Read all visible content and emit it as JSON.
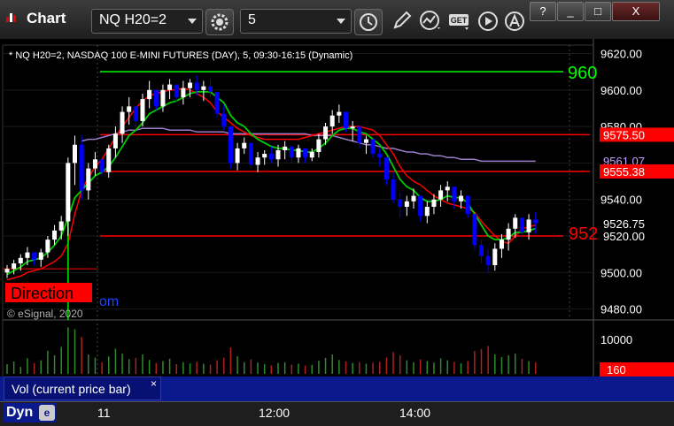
{
  "app": {
    "title": "Chart",
    "symbol": "NQ H20=2",
    "interval": "5"
  },
  "toolbar": {
    "icons": [
      "settings-gear-icon",
      "clock-icon",
      "pencil-draw-icon",
      "study-icon",
      "get-data-icon",
      "play-icon",
      "annotate-icon"
    ],
    "get_label": "GET"
  },
  "window_buttons": [
    "?",
    "_",
    "□",
    "X"
  ],
  "chart_header": "* NQ H20=2, NASDAQ 100 E-MINI FUTURES (DAY), 5, 09:30-16:15 (Dynamic)",
  "overlays": {
    "direction_label": "Direction",
    "copyright": "© eSignal, 2020",
    "partial_com": "om"
  },
  "price_axis": {
    "ticks": [
      "9620.00",
      "9600.00",
      "9580.00",
      "9560.00",
      "9540.00",
      "9520.00",
      "9500.00",
      "9480.00"
    ]
  },
  "price_tags": [
    {
      "text": "9575.50",
      "bg": "#ff0000",
      "fg": "#ffffff"
    },
    {
      "text": "9561.07",
      "bg": "#000000",
      "fg": "#c8a0ff"
    },
    {
      "text": "9555.38",
      "bg": "#ff0000",
      "fg": "#ffffff"
    },
    {
      "text": "9526.75",
      "bg": "#000000",
      "fg": "#ffffff"
    },
    {
      "text": "9520.00",
      "bg": "#000000",
      "fg": "#ffffff"
    }
  ],
  "line_labels": {
    "green_line": "960",
    "red_line": "952"
  },
  "volume_axis": {
    "tick": "10000",
    "current_tag": "160"
  },
  "volume_panel": {
    "label": "Vol (current price bar)",
    "close": "×"
  },
  "time_axis": {
    "labels": [
      "11",
      "12:00",
      "14:00"
    ],
    "dyn_label": "Dyn"
  },
  "colors": {
    "up": "#ffffff",
    "down": "#0000ff",
    "ma_fast": "#00cc00",
    "ma_slow": "#ff0000",
    "ma_long": "#9a7cc8",
    "hline_green": "#00ff00",
    "hline_red": "#ff0000",
    "vol_up": "#2e8b2e",
    "vol_down": "#b02020"
  },
  "chart_data": {
    "type": "candlestick",
    "title": "* NQ H20=2, NASDAQ 100 E-MINI FUTURES (DAY), 5, 09:30-16:15 (Dynamic)",
    "ylim": [
      9474,
      9628
    ],
    "x_tick_labels": [
      "11",
      "12:00",
      "14:00"
    ],
    "horizontal_lines": [
      {
        "name": "960",
        "value": 9610,
        "color": "green"
      },
      {
        "name": "952",
        "value": 9520,
        "color": "red"
      },
      {
        "name": "9575.50",
        "value": 9575.5,
        "color": "red"
      },
      {
        "name": "9555.38",
        "value": 9555.38,
        "color": "red"
      }
    ],
    "candles": [
      [
        9500,
        9504,
        9497,
        9502
      ],
      [
        9502,
        9507,
        9499,
        9505
      ],
      [
        9505,
        9510,
        9501,
        9508
      ],
      [
        9508,
        9514,
        9504,
        9511
      ],
      [
        9511,
        9509,
        9504,
        9507
      ],
      [
        9507,
        9513,
        9503,
        9511
      ],
      [
        9511,
        9520,
        9508,
        9518
      ],
      [
        9518,
        9526,
        9515,
        9523
      ],
      [
        9523,
        9531,
        9518,
        9528
      ],
      [
        9528,
        9563,
        9520,
        9560
      ],
      [
        9560,
        9575,
        9548,
        9570
      ],
      [
        9570,
        9575,
        9540,
        9545
      ],
      [
        9545,
        9560,
        9540,
        9557
      ],
      [
        9557,
        9566,
        9553,
        9562
      ],
      [
        9562,
        9558,
        9553,
        9555
      ],
      [
        9555,
        9570,
        9552,
        9568
      ],
      [
        9568,
        9580,
        9563,
        9576
      ],
      [
        9576,
        9591,
        9571,
        9588
      ],
      [
        9588,
        9596,
        9581,
        9591
      ],
      [
        9591,
        9587,
        9580,
        9583
      ],
      [
        9583,
        9598,
        9580,
        9595
      ],
      [
        9595,
        9605,
        9590,
        9600
      ],
      [
        9600,
        9596,
        9589,
        9591
      ],
      [
        9591,
        9603,
        9588,
        9600
      ],
      [
        9600,
        9606,
        9595,
        9603
      ],
      [
        9603,
        9600,
        9593,
        9596
      ],
      [
        9596,
        9605,
        9592,
        9601
      ],
      [
        9601,
        9606,
        9596,
        9604
      ],
      [
        9604,
        9608,
        9597,
        9600
      ],
      [
        9600,
        9605,
        9594,
        9602
      ],
      [
        9602,
        9606,
        9596,
        9599
      ],
      [
        9599,
        9595,
        9585,
        9587
      ],
      [
        9587,
        9592,
        9578,
        9580
      ],
      [
        9580,
        9576,
        9557,
        9560
      ],
      [
        9560,
        9571,
        9556,
        9568
      ],
      [
        9568,
        9574,
        9565,
        9571
      ],
      [
        9571,
        9566,
        9557,
        9559
      ],
      [
        9559,
        9566,
        9555,
        9563
      ],
      [
        9563,
        9567,
        9559,
        9565
      ],
      [
        9565,
        9569,
        9560,
        9562
      ],
      [
        9562,
        9570,
        9558,
        9567
      ],
      [
        9567,
        9572,
        9562,
        9569
      ],
      [
        9569,
        9566,
        9560,
        9563
      ],
      [
        9563,
        9570,
        9560,
        9568
      ],
      [
        9568,
        9565,
        9560,
        9563
      ],
      [
        9563,
        9568,
        9561,
        9566
      ],
      [
        9566,
        9576,
        9563,
        9573
      ],
      [
        9573,
        9582,
        9570,
        9580
      ],
      [
        9580,
        9589,
        9576,
        9586
      ],
      [
        9586,
        9592,
        9582,
        9588
      ],
      [
        9588,
        9586,
        9577,
        9579
      ],
      [
        9579,
        9583,
        9572,
        9580
      ],
      [
        9580,
        9577,
        9568,
        9571
      ],
      [
        9571,
        9575,
        9565,
        9573
      ],
      [
        9573,
        9571,
        9563,
        9565
      ],
      [
        9565,
        9568,
        9558,
        9563
      ],
      [
        9563,
        9560,
        9548,
        9551
      ],
      [
        9551,
        9555,
        9538,
        9540
      ],
      [
        9540,
        9544,
        9530,
        9536
      ],
      [
        9536,
        9542,
        9531,
        9539
      ],
      [
        9539,
        9546,
        9535,
        9542
      ],
      [
        9542,
        9540,
        9528,
        9531
      ],
      [
        9531,
        9539,
        9527,
        9536
      ],
      [
        9536,
        9543,
        9532,
        9540
      ],
      [
        9540,
        9548,
        9536,
        9545
      ],
      [
        9545,
        9550,
        9539,
        9547
      ],
      [
        9547,
        9544,
        9535,
        9539
      ],
      [
        9539,
        9545,
        9535,
        9542
      ],
      [
        9542,
        9540,
        9530,
        9532
      ],
      [
        9532,
        9528,
        9512,
        9515
      ],
      [
        9515,
        9518,
        9505,
        9509
      ],
      [
        9509,
        9513,
        9500,
        9504
      ],
      [
        9504,
        9516,
        9501,
        9513
      ],
      [
        9513,
        9521,
        9508,
        9518
      ],
      [
        9518,
        9527,
        9512,
        9524
      ],
      [
        9524,
        9532,
        9519,
        9530
      ],
      [
        9530,
        9528,
        9519,
        9522
      ],
      [
        9522,
        9532,
        9518,
        9529
      ],
      [
        9529,
        9533,
        9521,
        9527
      ]
    ],
    "ma_fast": [
      9499,
      9501,
      9503,
      9506,
      9507,
      9508,
      9511,
      9515,
      9520,
      9530,
      9541,
      9545,
      9549,
      9553,
      9555,
      9558,
      9563,
      9569,
      9575,
      9578,
      9582,
      9587,
      9589,
      9591,
      9593,
      9594,
      9596,
      9598,
      9599,
      9599,
      9599,
      9596,
      9593,
      9586,
      9582,
      9580,
      9576,
      9573,
      9571,
      9569,
      9568,
      9568,
      9567,
      9567,
      9566,
      9566,
      9568,
      9571,
      9575,
      9578,
      9579,
      9579,
      9577,
      9576,
      9573,
      9570,
      9565,
      9558,
      9551,
      9547,
      9545,
      9541,
      9539,
      9539,
      9540,
      9542,
      9541,
      9541,
      9538,
      9532,
      9526,
      9520,
      9518,
      9518,
      9519,
      9522,
      9522,
      9523,
      9524
    ],
    "ma_slow": [
      9496,
      9497,
      9498,
      9500,
      9501,
      9502,
      9504,
      9506,
      9509,
      9516,
      9532,
      9545,
      9552,
      9558,
      9562,
      9568,
      9574,
      9580,
      9585,
      9590,
      9594,
      9597,
      9598,
      9599,
      9600,
      9600,
      9601,
      9600,
      9598,
      9596,
      9593,
      9588,
      9585,
      9582,
      9579,
      9577,
      9575,
      9574,
      9573,
      9573,
      9573,
      9573,
      9573,
      9573,
      9574,
      9575,
      9576,
      9577,
      9578,
      9579,
      9580,
      9580,
      9580,
      9579,
      9578,
      9575,
      9570,
      9565,
      9558,
      9553,
      9550,
      9548,
      9545,
      9542,
      9540,
      9538,
      9537,
      9536,
      9535,
      9533,
      9528,
      9524,
      9520,
      9517,
      9516,
      9520,
      9524,
      9525,
      9526
    ],
    "ma_long_start_index": 11,
    "ma_long": [
      9572,
      9573,
      9573,
      9574,
      9575,
      9576,
      9577,
      9578,
      9578,
      9579,
      9579,
      9579,
      9579,
      9578,
      9578,
      9578,
      9578,
      9577,
      9577,
      9577,
      9577,
      9577,
      9576,
      9576,
      9576,
      9576,
      9576,
      9576,
      9576,
      9576,
      9576,
      9576,
      9576,
      9576,
      9575,
      9575,
      9575,
      9575,
      9574,
      9573,
      9572,
      9571,
      9570,
      9570,
      9569,
      9568,
      9568,
      9567,
      9566,
      9566,
      9565,
      9565,
      9564,
      9564,
      9563,
      9563,
      9562,
      9562,
      9562,
      9561,
      9561,
      9561,
      9561,
      9561,
      9561,
      9561,
      9561,
      9561
    ],
    "volume_ylim": [
      0,
      13000
    ],
    "volume_ticks": [
      10000
    ]
  }
}
